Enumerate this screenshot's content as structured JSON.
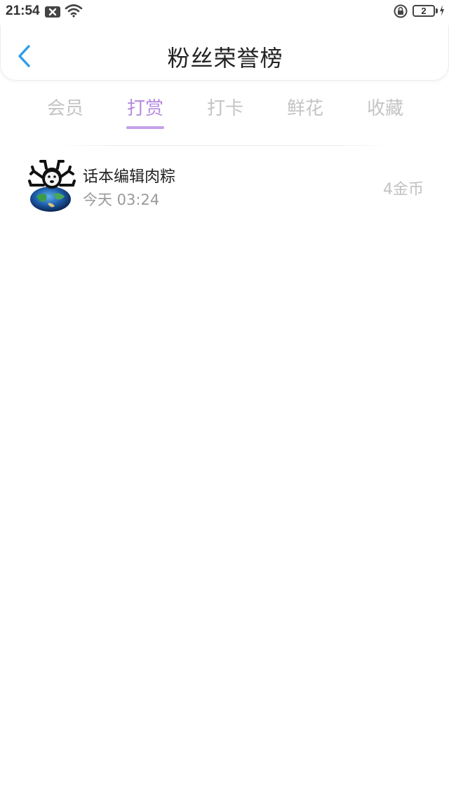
{
  "status_bar": {
    "time": "21:54",
    "battery_level": "2",
    "icons": [
      "notification-x-icon",
      "wifi-icon",
      "lock-rotation-icon",
      "battery-icon",
      "charging-icon"
    ]
  },
  "header": {
    "title": "粉丝荣誉榜",
    "back_icon": "chevron-left-icon",
    "back_color": "#2f9ee8"
  },
  "tabs": {
    "items": [
      {
        "label": "会员"
      },
      {
        "label": "打赏"
      },
      {
        "label": "打卡"
      },
      {
        "label": "鲜花"
      },
      {
        "label": "收藏"
      }
    ],
    "active": "打赏",
    "active_color": "#b68be0",
    "inactive_color": "#c4c4c4"
  },
  "list": {
    "items": [
      {
        "name": "话本编辑肉粽",
        "time": "今天 03:24",
        "amount": "4金币",
        "avatar_icon": "avatar-image"
      }
    ]
  }
}
